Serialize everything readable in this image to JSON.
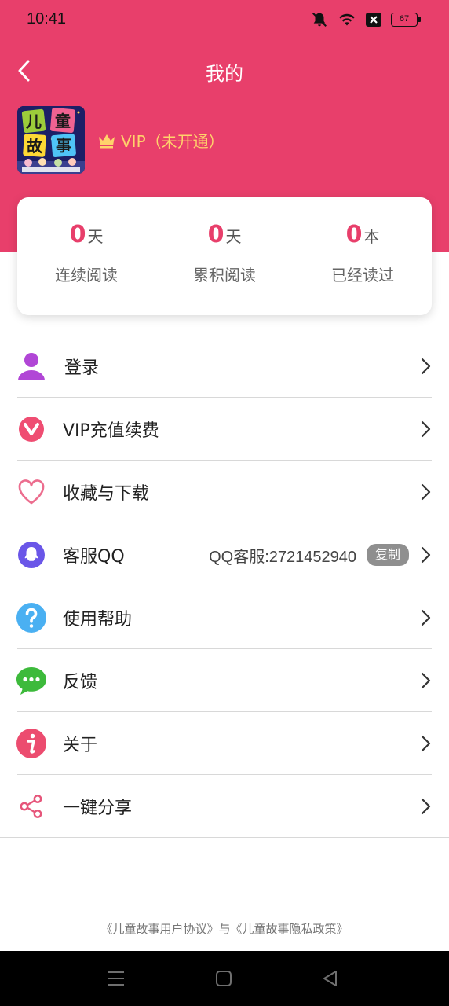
{
  "status_bar": {
    "time": "10:41",
    "battery": "67"
  },
  "header": {
    "title": "我的"
  },
  "profile": {
    "avatar_text": [
      "儿",
      "童",
      "故",
      "事"
    ],
    "vip_label": "VIP（未开通）"
  },
  "stats": [
    {
      "value": "0",
      "unit": "天",
      "label": "连续阅读"
    },
    {
      "value": "0",
      "unit": "天",
      "label": "累积阅读"
    },
    {
      "value": "0",
      "unit": "本",
      "label": "已经读过"
    }
  ],
  "menu": {
    "login": "登录",
    "vip": "VIP充值续费",
    "favorites": "收藏与下载",
    "service": "客服QQ",
    "service_info": "QQ客服:2721452940",
    "copy_label": "复制",
    "help": "使用帮助",
    "feedback": "反馈",
    "about": "关于",
    "share": "一键分享"
  },
  "footer": {
    "links": "《儿童故事用户协议》与《儿童故事隐私政策》"
  },
  "colors": {
    "brand": "#e83f6b",
    "vip_gold": "#ffd36b"
  }
}
